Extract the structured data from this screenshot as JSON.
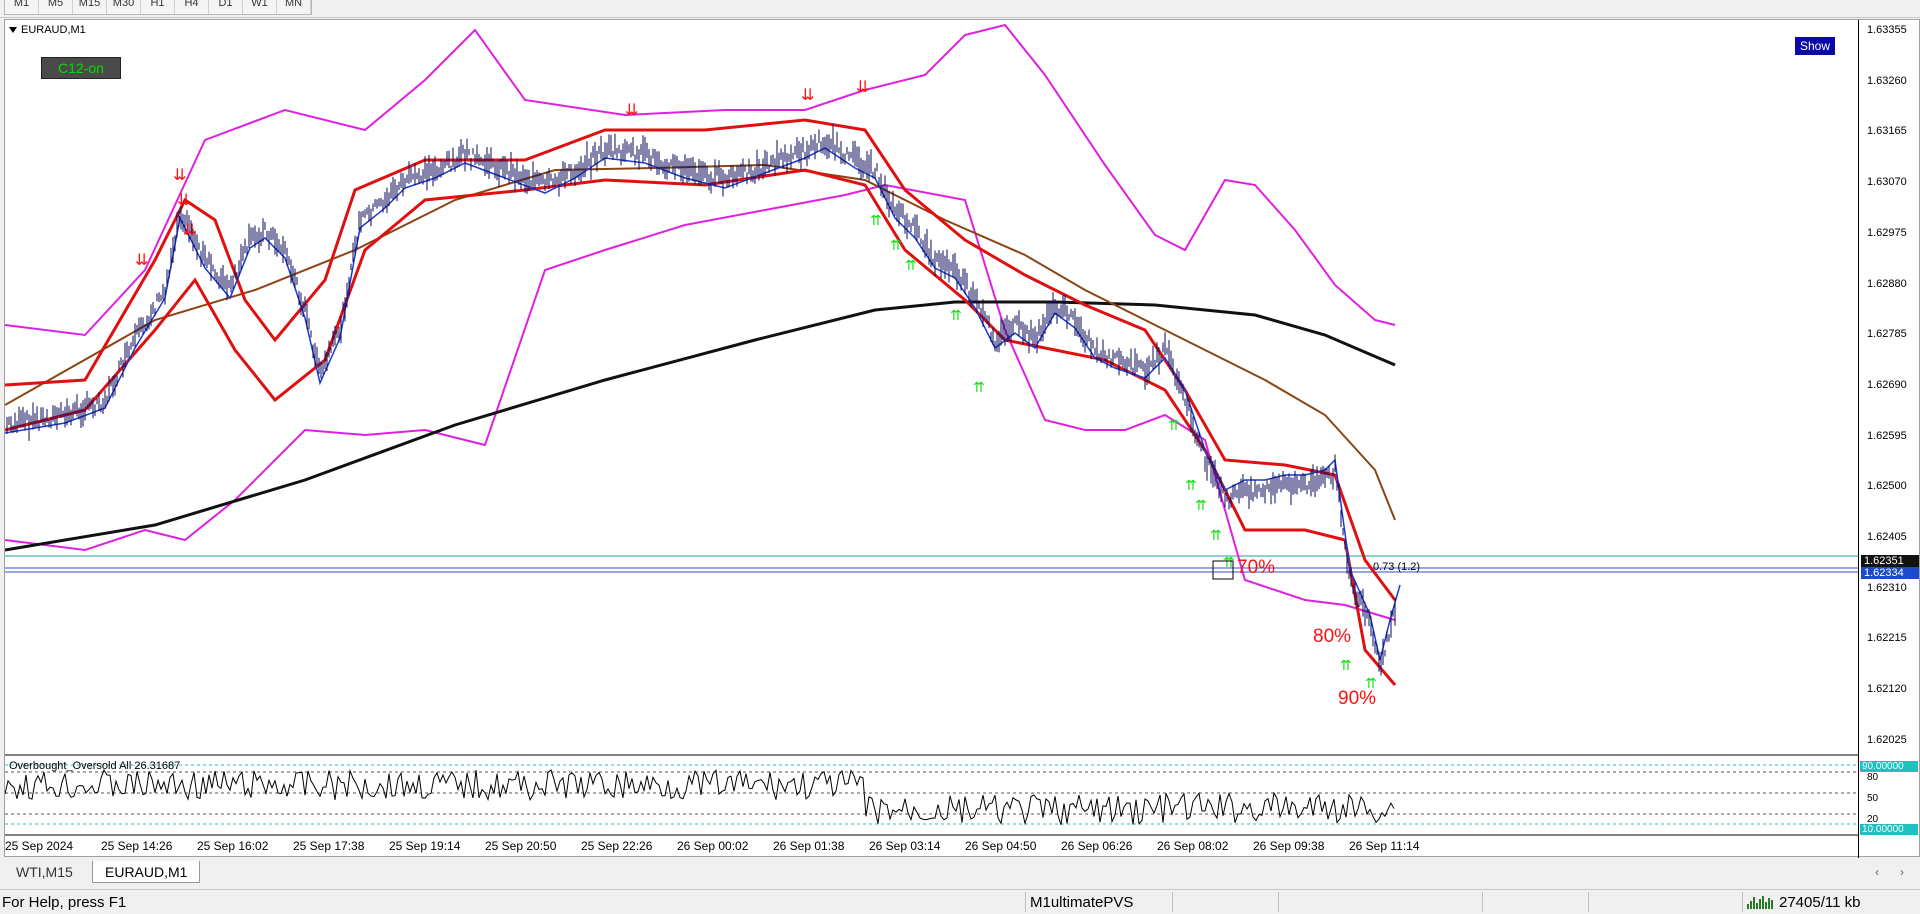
{
  "timeframes": [
    "M1",
    "M5",
    "M15",
    "M30",
    "H1",
    "H4",
    "D1",
    "W1",
    "MN"
  ],
  "chart": {
    "title": "EURAUD,M1",
    "c12_label": "C12-on",
    "show_label": "Show",
    "price_ticks": [
      "1.63355",
      "1.63260",
      "1.63165",
      "1.63070",
      "1.62975",
      "1.62880",
      "1.62785",
      "1.62690",
      "1.62595",
      "1.62500",
      "1.62405",
      "1.62310",
      "1.62215",
      "1.62120",
      "1.62025"
    ],
    "price_tag_bid": "1.62351",
    "price_tag_ask": "1.62334",
    "time_ticks": [
      "25 Sep 2024",
      "25 Sep 14:26",
      "25 Sep 16:02",
      "25 Sep 17:38",
      "25 Sep 19:14",
      "25 Sep 20:50",
      "25 Sep 22:26",
      "26 Sep 00:02",
      "26 Sep 01:38",
      "26 Sep 03:14",
      "26 Sep 04:50",
      "26 Sep 06:26",
      "26 Sep 08:02",
      "26 Sep 09:38",
      "26 Sep 11:14"
    ],
    "pct_labels": [
      "70%",
      "80%",
      "90%"
    ],
    "level_label": "0.73 (1.2)",
    "indicator": {
      "label": "Overbought_Oversold All 26.31687",
      "ticks": [
        "90.00000",
        "80",
        "50",
        "20",
        "10.00000"
      ]
    },
    "colors": {
      "price_bars": "#0a0a5a",
      "envelope": "#e020e0",
      "ma_red": "#e01010",
      "ma_brown": "#8b4513",
      "ma_blue": "#1a3ad0",
      "ma_long": "#111111",
      "signal_down": "#ff1010",
      "signal_up": "#10e010",
      "level_line": "#20a0a0"
    }
  },
  "tabs": [
    "WTI,M15",
    "EURAUD,M1"
  ],
  "status": {
    "help": "For Help, press F1",
    "profile": "M1ultimatePVS",
    "traffic": "27405/11 kb"
  }
}
